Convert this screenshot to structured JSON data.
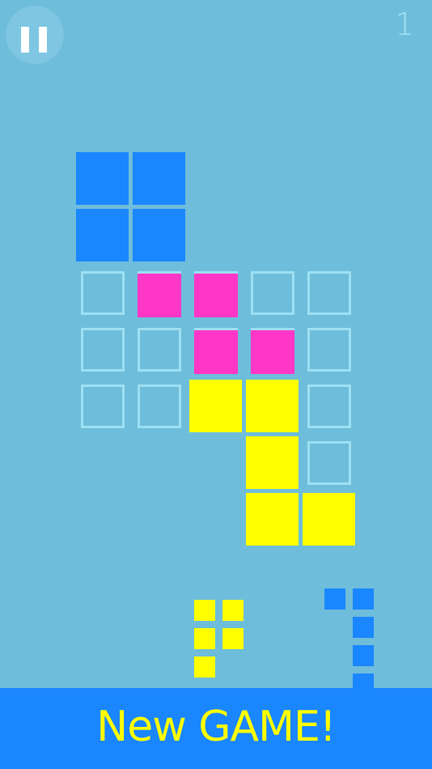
{
  "colors": {
    "background": "#6ebddb",
    "empty_slot_border": "#9ee0f2",
    "blue": "#1a86ff",
    "magenta": "#ff36c6",
    "yellow": "#ffff00",
    "pause_circle": "#7ec6e2",
    "score_text": "#a8e2f3",
    "button_text": "#ffff00"
  },
  "hud": {
    "pause_icon": "pause-icon",
    "score": "1"
  },
  "board": {
    "empty_slots": [
      [
        0,
        0
      ],
      [
        0,
        1
      ],
      [
        0,
        2
      ],
      [
        0,
        3
      ],
      [
        0,
        4
      ],
      [
        1,
        0
      ],
      [
        1,
        1
      ],
      [
        1,
        2
      ],
      [
        1,
        3
      ],
      [
        1,
        4
      ],
      [
        2,
        0
      ],
      [
        2,
        1
      ],
      [
        2,
        4
      ],
      [
        3,
        4
      ]
    ],
    "magenta_cells": [
      [
        0,
        1
      ],
      [
        0,
        2
      ],
      [
        1,
        2
      ],
      [
        1,
        3
      ]
    ],
    "yellow_cells": [
      [
        2,
        2
      ],
      [
        2,
        3
      ],
      [
        3,
        3
      ],
      [
        4,
        3
      ],
      [
        4,
        4
      ]
    ],
    "active_piece": {
      "color": "blue",
      "shape": "2x2 square"
    }
  },
  "tray": {
    "pieces": [
      {
        "color": "yellow",
        "shape": "F-shape"
      },
      {
        "color": "blue",
        "shape": "J-shape"
      }
    ]
  },
  "footer": {
    "new_game_label": "New GAME!"
  }
}
